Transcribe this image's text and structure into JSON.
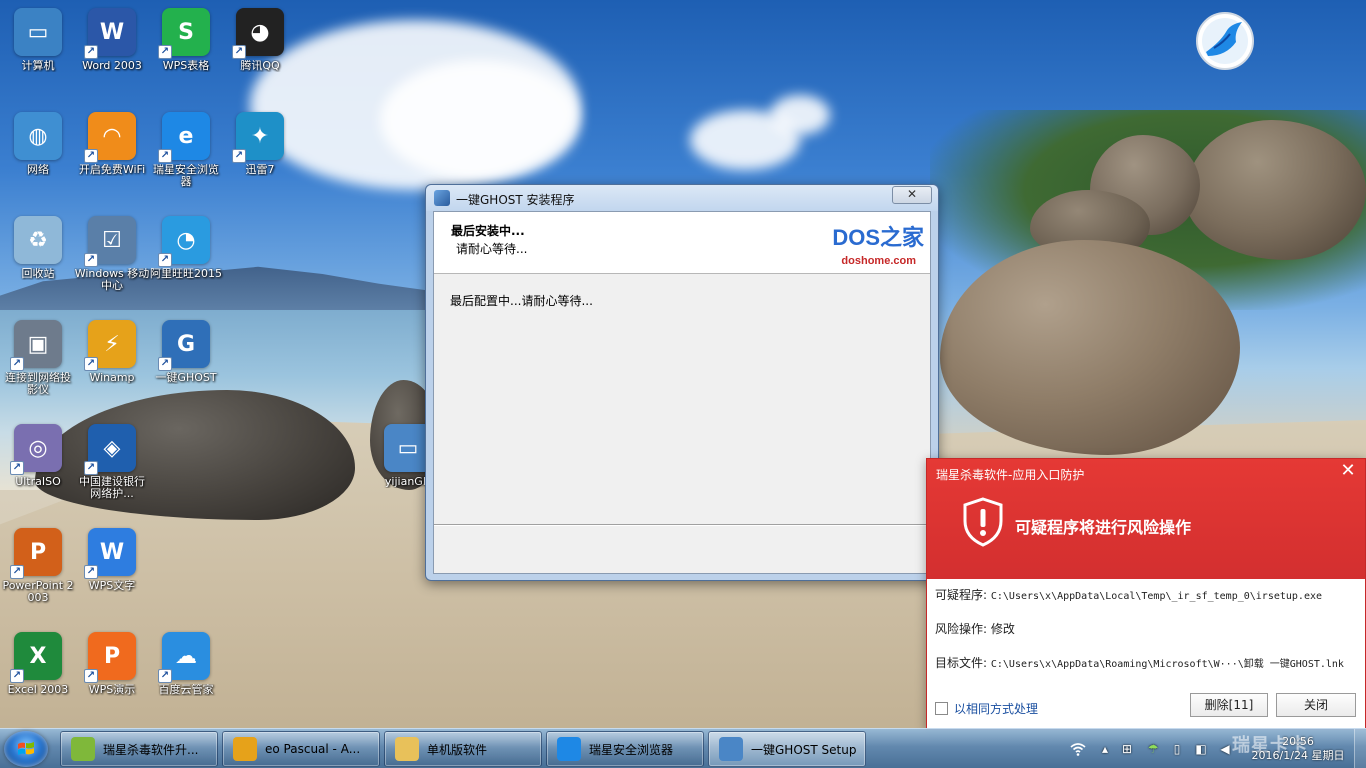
{
  "desktop": {
    "icons": [
      {
        "label": "计算机",
        "color": "#3b82c4",
        "glyph": "▭",
        "shortcut": false
      },
      {
        "label": "Word 2003",
        "color": "#2b57a8",
        "glyph": "W",
        "shortcut": true
      },
      {
        "label": "WPS表格",
        "color": "#23b14d",
        "glyph": "S",
        "shortcut": true
      },
      {
        "label": "腾讯QQ",
        "color": "#222222",
        "glyph": "◕",
        "shortcut": true
      },
      {
        "label": "网络",
        "color": "#3f8fd2",
        "glyph": "◍",
        "shortcut": false
      },
      {
        "label": "开启免费WiFi",
        "color": "#f08c1a",
        "glyph": "◠",
        "shortcut": true
      },
      {
        "label": "瑞星安全浏览器",
        "color": "#1e88e5",
        "glyph": "e",
        "shortcut": true
      },
      {
        "label": "迅雷7",
        "color": "#1e90c8",
        "glyph": "✦",
        "shortcut": true
      },
      {
        "label": "回收站",
        "color": "#8fb8d8",
        "glyph": "♻",
        "shortcut": false
      },
      {
        "label": "Windows 移动中心",
        "color": "#5a7fa8",
        "glyph": "☑",
        "shortcut": true
      },
      {
        "label": "阿里旺旺2015",
        "color": "#2a9be0",
        "glyph": "◔",
        "shortcut": true
      },
      {
        "label": "连接到网络投影仪",
        "color": "#6e7b8c",
        "glyph": "▣",
        "shortcut": true
      },
      {
        "label": "Winamp",
        "color": "#e6a21a",
        "glyph": "⚡",
        "shortcut": true
      },
      {
        "label": "一键GHOST",
        "color": "#2f6fb8",
        "glyph": "G",
        "shortcut": true
      },
      {
        "label": "UltraISO",
        "color": "#7a6fb0",
        "glyph": "◎",
        "shortcut": true
      },
      {
        "label": "中国建设银行网络护...",
        "color": "#1f5fae",
        "glyph": "◈",
        "shortcut": true
      },
      {
        "label": "PowerPoint 2003",
        "color": "#d2601a",
        "glyph": "P",
        "shortcut": true
      },
      {
        "label": "WPS文字",
        "color": "#2e7de0",
        "glyph": "W",
        "shortcut": true
      },
      {
        "label": "Excel 2003",
        "color": "#1f8a3c",
        "glyph": "X",
        "shortcut": true
      },
      {
        "label": "WPS演示",
        "color": "#f06a1e",
        "glyph": "P",
        "shortcut": true
      },
      {
        "label": "百度云管家",
        "color": "#2a8ee0",
        "glyph": "☁",
        "shortcut": true
      },
      {
        "label": "yijianGH",
        "color": "#4a86c6",
        "glyph": "▭",
        "shortcut": false
      }
    ],
    "brand_logo": "rising-bird-logo"
  },
  "installer": {
    "window_title": "一键GHOST 安装程序",
    "close_glyph": "✕",
    "header_title": "最后安装中...",
    "header_subtitle": "请耐心等待...",
    "logo_text": "DOS之家",
    "logo_url_text": "doshome.com",
    "status_text": "最后配置中...请耐心等待..."
  },
  "av_popup": {
    "title": "瑞星杀毒软件-应用入口防护",
    "close_glyph": "✕",
    "warning": "可疑程序将进行风险操作",
    "program_label": "可疑程序:",
    "program_value": "C:\\Users\\x\\AppData\\Local\\Temp\\_ir_sf_temp_0\\irsetup.exe",
    "operation_label": "风险操作:",
    "operation_value": "修改",
    "target_label": "目标文件:",
    "target_value": "C:\\Users\\x\\AppData\\Roaming\\Microsoft\\W···\\卸载 一键GHOST.lnk",
    "same_handling_label": "以相同方式处理",
    "delete_label": "删除[11]",
    "close_label": "关闭",
    "accent_color": "#e53935"
  },
  "taskbar": {
    "buttons": [
      {
        "label": "瑞星杀毒软件升...",
        "icon_color": "#7fb83a"
      },
      {
        "label": "eo Pascual - A...",
        "icon_color": "#e6a21a"
      },
      {
        "label": "单机版软件",
        "icon_color": "#e8c15a"
      },
      {
        "label": "瑞星安全浏览器",
        "icon_color": "#1e88e5"
      },
      {
        "label": "一键GHOST Setup",
        "icon_color": "#4a86c6"
      }
    ],
    "tray_icons": [
      "wifi-icon",
      "chevron-up-icon",
      "network-icon",
      "umbrella-icon",
      "usb-icon",
      "security-icon",
      "volume-icon",
      "speaker-icon"
    ],
    "clock_time": "20:56",
    "clock_date": "2016/1/24 星期日",
    "watermark": "瑞星卡卡"
  }
}
